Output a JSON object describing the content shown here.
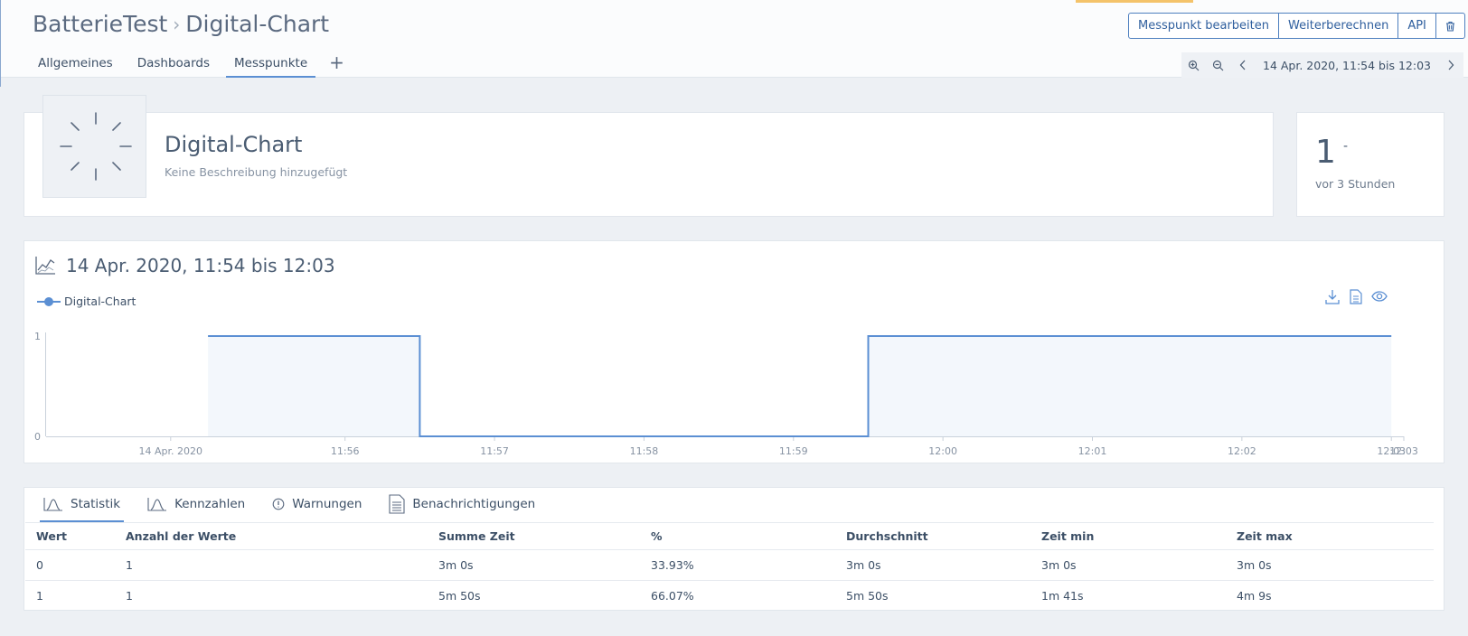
{
  "header": {
    "project": "BatterieTest",
    "separator": "›",
    "title": "Digital-Chart",
    "actions": [
      "Messpunkt bearbeiten",
      "Weiterberechnen",
      "API"
    ]
  },
  "tabs": [
    {
      "label": "Allgemeines",
      "active": false
    },
    {
      "label": "Dashboards",
      "active": false
    },
    {
      "label": "Messpunkte",
      "active": true
    }
  ],
  "add_tab_label": "+",
  "time_range": "14 Apr. 2020, 11:54 bis 12:03",
  "datapoint": {
    "name": "Digital-Chart",
    "description": "Keine Beschreibung hinzugefügt",
    "current_value": "1",
    "unit": "-",
    "last_update": "vor 3 Stunden"
  },
  "chart_panel": {
    "title": "14 Apr. 2020, 11:54 bis 12:03",
    "accent": "#5b8fd3"
  },
  "chart_data": {
    "type": "line",
    "step": true,
    "series": [
      {
        "name": "Digital-Chart",
        "points": [
          {
            "x": "11:55:05",
            "y": 1
          },
          {
            "x": "11:56:30",
            "y": 1
          },
          {
            "x": "11:56:30",
            "y": 0
          },
          {
            "x": "11:59:30",
            "y": 0
          },
          {
            "x": "11:59:30",
            "y": 1
          },
          {
            "x": "12:03:00",
            "y": 1
          }
        ]
      }
    ],
    "x_ticks": [
      "14 Apr. 2020",
      "11:56",
      "11:57",
      "11:58",
      "11:59",
      "12:00",
      "12:01",
      "12:02",
      "12:03",
      "12:03"
    ],
    "y_ticks": [
      "0",
      "1"
    ],
    "ylim": [
      0,
      1
    ],
    "grid": false,
    "legend_position": "top-left"
  },
  "stat_tabs": [
    {
      "label": "Statistik",
      "active": true
    },
    {
      "label": "Kennzahlen",
      "active": false
    },
    {
      "label": "Warnungen",
      "active": false
    },
    {
      "label": "Benachrichtigungen",
      "active": false
    }
  ],
  "stats_table": {
    "headers": [
      "Wert",
      "Anzahl der Werte",
      "Summe Zeit",
      "%",
      "Durchschnitt",
      "Zeit min",
      "Zeit max"
    ],
    "rows": [
      [
        "0",
        "1",
        "3m 0s",
        "33.93%",
        "3m 0s",
        "3m 0s",
        "3m 0s"
      ],
      [
        "1",
        "1",
        "5m 50s",
        "66.07%",
        "5m 50s",
        "1m 41s",
        "4m 9s"
      ]
    ]
  }
}
